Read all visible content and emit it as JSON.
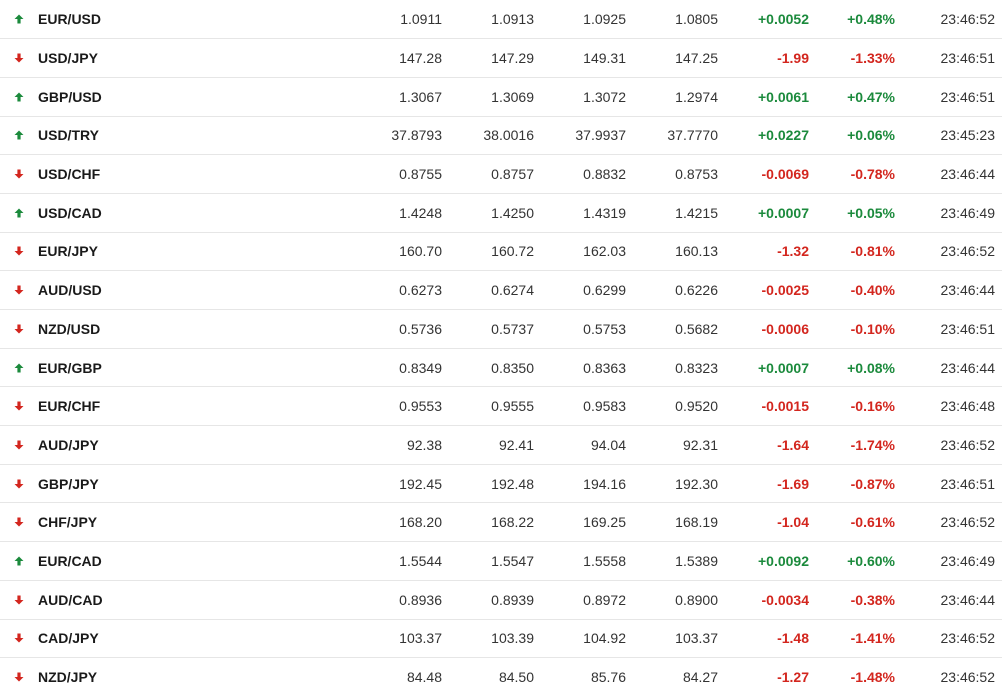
{
  "colors": {
    "up": "#1b8a3c",
    "down": "#d3261e"
  },
  "rows": [
    {
      "symbol": "EUR/USD",
      "dir": "up",
      "last": "1.0911",
      "ask": "1.0913",
      "high": "1.0925",
      "low": "1.0805",
      "change": "+0.0052",
      "pct": "+0.48%",
      "time": "23:46:52"
    },
    {
      "symbol": "USD/JPY",
      "dir": "down",
      "last": "147.28",
      "ask": "147.29",
      "high": "149.31",
      "low": "147.25",
      "change": "-1.99",
      "pct": "-1.33%",
      "time": "23:46:51"
    },
    {
      "symbol": "GBP/USD",
      "dir": "up",
      "last": "1.3067",
      "ask": "1.3069",
      "high": "1.3072",
      "low": "1.2974",
      "change": "+0.0061",
      "pct": "+0.47%",
      "time": "23:46:51"
    },
    {
      "symbol": "USD/TRY",
      "dir": "up",
      "last": "37.8793",
      "ask": "38.0016",
      "high": "37.9937",
      "low": "37.7770",
      "change": "+0.0227",
      "pct": "+0.06%",
      "time": "23:45:23"
    },
    {
      "symbol": "USD/CHF",
      "dir": "down",
      "last": "0.8755",
      "ask": "0.8757",
      "high": "0.8832",
      "low": "0.8753",
      "change": "-0.0069",
      "pct": "-0.78%",
      "time": "23:46:44"
    },
    {
      "symbol": "USD/CAD",
      "dir": "up",
      "last": "1.4248",
      "ask": "1.4250",
      "high": "1.4319",
      "low": "1.4215",
      "change": "+0.0007",
      "pct": "+0.05%",
      "time": "23:46:49"
    },
    {
      "symbol": "EUR/JPY",
      "dir": "down",
      "last": "160.70",
      "ask": "160.72",
      "high": "162.03",
      "low": "160.13",
      "change": "-1.32",
      "pct": "-0.81%",
      "time": "23:46:52"
    },
    {
      "symbol": "AUD/USD",
      "dir": "down",
      "last": "0.6273",
      "ask": "0.6274",
      "high": "0.6299",
      "low": "0.6226",
      "change": "-0.0025",
      "pct": "-0.40%",
      "time": "23:46:44"
    },
    {
      "symbol": "NZD/USD",
      "dir": "down",
      "last": "0.5736",
      "ask": "0.5737",
      "high": "0.5753",
      "low": "0.5682",
      "change": "-0.0006",
      "pct": "-0.10%",
      "time": "23:46:51"
    },
    {
      "symbol": "EUR/GBP",
      "dir": "up",
      "last": "0.8349",
      "ask": "0.8350",
      "high": "0.8363",
      "low": "0.8323",
      "change": "+0.0007",
      "pct": "+0.08%",
      "time": "23:46:44"
    },
    {
      "symbol": "EUR/CHF",
      "dir": "down",
      "last": "0.9553",
      "ask": "0.9555",
      "high": "0.9583",
      "low": "0.9520",
      "change": "-0.0015",
      "pct": "-0.16%",
      "time": "23:46:48"
    },
    {
      "symbol": "AUD/JPY",
      "dir": "down",
      "last": "92.38",
      "ask": "92.41",
      "high": "94.04",
      "low": "92.31",
      "change": "-1.64",
      "pct": "-1.74%",
      "time": "23:46:52"
    },
    {
      "symbol": "GBP/JPY",
      "dir": "down",
      "last": "192.45",
      "ask": "192.48",
      "high": "194.16",
      "low": "192.30",
      "change": "-1.69",
      "pct": "-0.87%",
      "time": "23:46:51"
    },
    {
      "symbol": "CHF/JPY",
      "dir": "down",
      "last": "168.20",
      "ask": "168.22",
      "high": "169.25",
      "low": "168.19",
      "change": "-1.04",
      "pct": "-0.61%",
      "time": "23:46:52"
    },
    {
      "symbol": "EUR/CAD",
      "dir": "up",
      "last": "1.5544",
      "ask": "1.5547",
      "high": "1.5558",
      "low": "1.5389",
      "change": "+0.0092",
      "pct": "+0.60%",
      "time": "23:46:49"
    },
    {
      "symbol": "AUD/CAD",
      "dir": "down",
      "last": "0.8936",
      "ask": "0.8939",
      "high": "0.8972",
      "low": "0.8900",
      "change": "-0.0034",
      "pct": "-0.38%",
      "time": "23:46:44"
    },
    {
      "symbol": "CAD/JPY",
      "dir": "down",
      "last": "103.37",
      "ask": "103.39",
      "high": "104.92",
      "low": "103.37",
      "change": "-1.48",
      "pct": "-1.41%",
      "time": "23:46:52"
    },
    {
      "symbol": "NZD/JPY",
      "dir": "down",
      "last": "84.48",
      "ask": "84.50",
      "high": "85.76",
      "low": "84.27",
      "change": "-1.27",
      "pct": "-1.48%",
      "time": "23:46:52"
    }
  ]
}
